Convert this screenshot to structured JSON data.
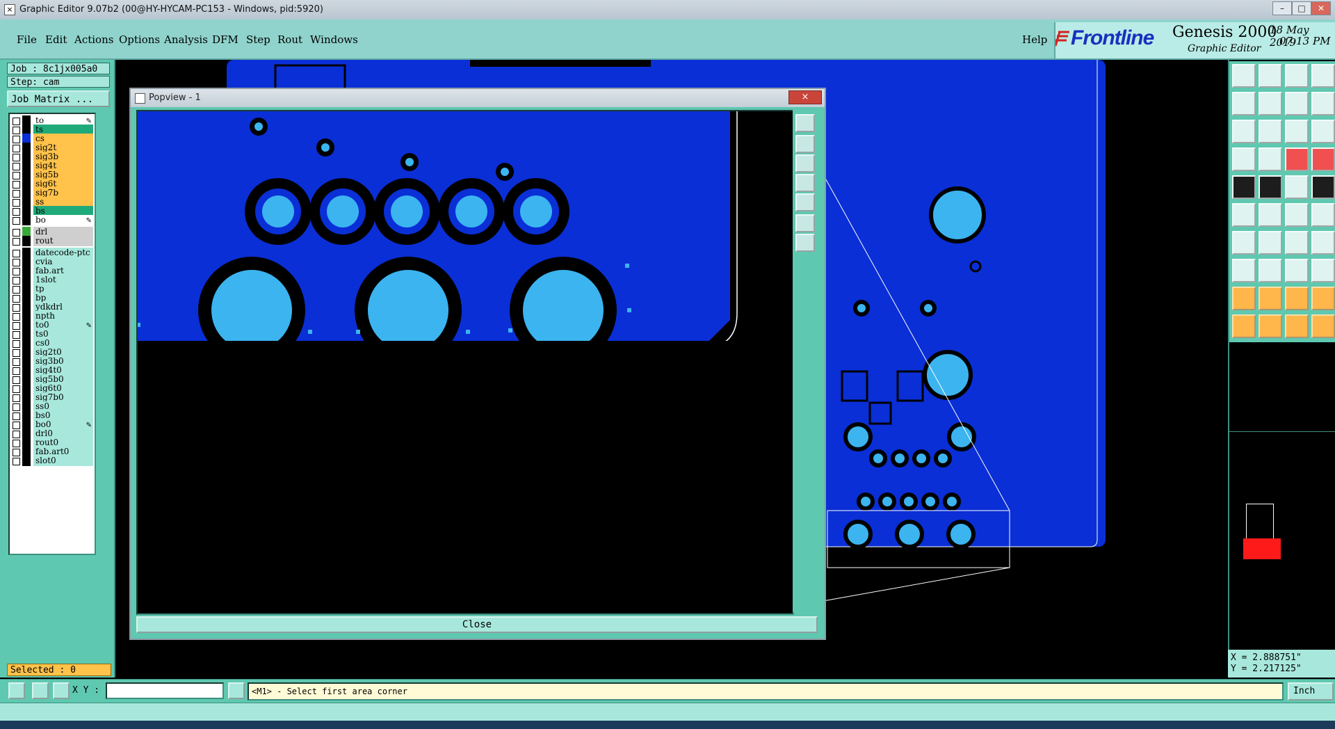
{
  "window": {
    "title": "Graphic Editor 9.07b2 (00@HY-HYCAM-PC153 - Windows, pid:5920)"
  },
  "menu": {
    "items": [
      "File",
      "Edit",
      "Actions",
      "Options",
      "Analysis",
      "DFM",
      "Step",
      "Rout",
      "Windows"
    ],
    "help": "Help"
  },
  "brand": {
    "logo_text": "Frontline",
    "product": "Genesis 2000",
    "module": "Graphic Editor",
    "date": "18 May 2019",
    "time": "07:13 PM"
  },
  "job": {
    "job": "Job : 8c1jx005a0",
    "step": "Step: cam",
    "matrix_button": "Job Matrix ..."
  },
  "layers": [
    {
      "name": "to",
      "color": "#ffffff",
      "swatch": "#000000",
      "pen": true
    },
    {
      "name": "ts",
      "color": "#1faa7a",
      "swatch": "#000000",
      "pen": false
    },
    {
      "name": "cs",
      "color": "#ffc24a",
      "swatch": "#0a2fd6",
      "pen": false
    },
    {
      "name": "sig2t",
      "color": "#ffc24a",
      "swatch": "#000000",
      "pen": false
    },
    {
      "name": "sig3b",
      "color": "#ffc24a",
      "swatch": "#000000",
      "pen": false
    },
    {
      "name": "sig4t",
      "color": "#ffc24a",
      "swatch": "#000000",
      "pen": false
    },
    {
      "name": "sig5b",
      "color": "#ffc24a",
      "swatch": "#000000",
      "pen": false
    },
    {
      "name": "sig6t",
      "color": "#ffc24a",
      "swatch": "#000000",
      "pen": false
    },
    {
      "name": "sig7b",
      "color": "#ffc24a",
      "swatch": "#000000",
      "pen": false
    },
    {
      "name": "ss",
      "color": "#ffc24a",
      "swatch": "#000000",
      "pen": false
    },
    {
      "name": "bs",
      "color": "#1faa7a",
      "swatch": "#000000",
      "pen": false
    },
    {
      "name": "bo",
      "color": "#ffffff",
      "swatch": "#000000",
      "pen": true
    },
    {
      "name": "drl",
      "color": "#cfcfcf",
      "swatch": "#3aa838",
      "pen": false,
      "gap": true
    },
    {
      "name": "rout",
      "color": "#cfcfcf",
      "swatch": "#000000",
      "pen": false
    },
    {
      "name": "datecode-ptc",
      "color": "#a8e8dc",
      "swatch": "#000000",
      "pen": false,
      "gap": true
    },
    {
      "name": "cvia",
      "color": "#a8e8dc",
      "swatch": "#000000",
      "pen": false
    },
    {
      "name": "fab.art",
      "color": "#a8e8dc",
      "swatch": "#000000",
      "pen": false
    },
    {
      "name": "1slot",
      "color": "#a8e8dc",
      "swatch": "#000000",
      "pen": false
    },
    {
      "name": "tp",
      "color": "#a8e8dc",
      "swatch": "#000000",
      "pen": false
    },
    {
      "name": "bp",
      "color": "#a8e8dc",
      "swatch": "#000000",
      "pen": false
    },
    {
      "name": "ydkdrl",
      "color": "#a8e8dc",
      "swatch": "#000000",
      "pen": false
    },
    {
      "name": "npth",
      "color": "#a8e8dc",
      "swatch": "#000000",
      "pen": false
    },
    {
      "name": "to0",
      "color": "#a8e8dc",
      "swatch": "#000000",
      "pen": true
    },
    {
      "name": "ts0",
      "color": "#a8e8dc",
      "swatch": "#000000",
      "pen": false
    },
    {
      "name": "cs0",
      "color": "#a8e8dc",
      "swatch": "#000000",
      "pen": false
    },
    {
      "name": "sig2t0",
      "color": "#a8e8dc",
      "swatch": "#000000",
      "pen": false
    },
    {
      "name": "sig3b0",
      "color": "#a8e8dc",
      "swatch": "#000000",
      "pen": false
    },
    {
      "name": "sig4t0",
      "color": "#a8e8dc",
      "swatch": "#000000",
      "pen": false
    },
    {
      "name": "sig5b0",
      "color": "#a8e8dc",
      "swatch": "#000000",
      "pen": false
    },
    {
      "name": "sig6t0",
      "color": "#a8e8dc",
      "swatch": "#000000",
      "pen": false
    },
    {
      "name": "sig7b0",
      "color": "#a8e8dc",
      "swatch": "#000000",
      "pen": false
    },
    {
      "name": "ss0",
      "color": "#a8e8dc",
      "swatch": "#000000",
      "pen": false
    },
    {
      "name": "bs0",
      "color": "#a8e8dc",
      "swatch": "#000000",
      "pen": false
    },
    {
      "name": "bo0",
      "color": "#a8e8dc",
      "swatch": "#000000",
      "pen": true
    },
    {
      "name": "drl0",
      "color": "#a8e8dc",
      "swatch": "#000000",
      "pen": false
    },
    {
      "name": "rout0",
      "color": "#a8e8dc",
      "swatch": "#000000",
      "pen": false
    },
    {
      "name": "fab.art0",
      "color": "#a8e8dc",
      "swatch": "#000000",
      "pen": false
    },
    {
      "name": "slot0",
      "color": "#a8e8dc",
      "swatch": "#000000",
      "pen": false
    }
  ],
  "selected": "Selected : 0",
  "popview": {
    "title": "Popview - 1",
    "close_x": "×",
    "close_button": "Close"
  },
  "coords": {
    "x": "X = 2.888751\"",
    "y": "Y = 2.217125\""
  },
  "bottom": {
    "xy_label": "X Y :",
    "xy_value": "",
    "prompt": "<M1> - Select first area corner",
    "units": "Inch"
  },
  "colors": {
    "copper": "#0a2fd6",
    "pad": "#3cb4f0",
    "panel": "#5fc8b0",
    "panel_light": "#a8e8dc",
    "highlight": "#ffc24a"
  }
}
